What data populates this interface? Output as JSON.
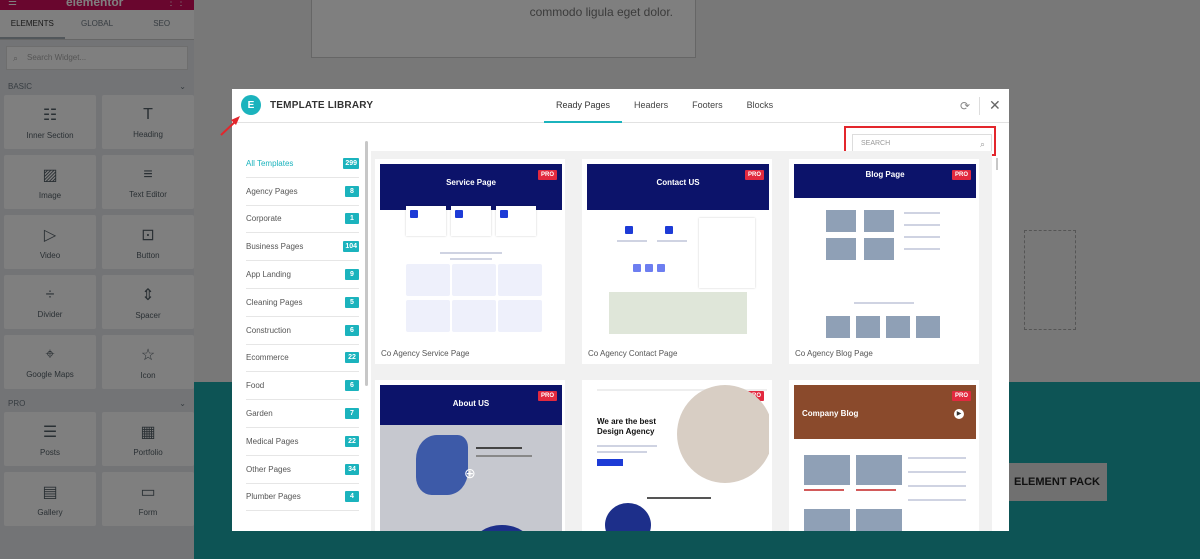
{
  "editor": {
    "logo": "elementor",
    "tabs": [
      "ELEMENTS",
      "GLOBAL",
      "SEO"
    ],
    "search_placeholder": "Search Widget...",
    "basic_title": "BASIC",
    "pro_title": "PRO",
    "basic_widgets": [
      "Inner Section",
      "Heading",
      "Image",
      "Text Editor",
      "Video",
      "Button",
      "Divider",
      "Spacer",
      "Google Maps",
      "Icon"
    ],
    "pro_widgets": [
      "Posts",
      "Portfolio",
      "Gallery",
      "Form"
    ]
  },
  "canvas": {
    "box_text": "commodo ligula eget dolor.",
    "button_text": "ELEMENT PACK"
  },
  "modal": {
    "title": "TEMPLATE LIBRARY",
    "logo_letter": "E",
    "tabs": [
      "Ready Pages",
      "Headers",
      "Footers",
      "Blocks"
    ],
    "active_tab": "Ready Pages",
    "search_placeholder": "SEARCH",
    "categories": [
      {
        "label": "All Templates",
        "count": "299"
      },
      {
        "label": "Agency Pages",
        "count": "8"
      },
      {
        "label": "Corporate",
        "count": "1"
      },
      {
        "label": "Business Pages",
        "count": "104"
      },
      {
        "label": "App Landing",
        "count": "9"
      },
      {
        "label": "Cleaning Pages",
        "count": "5"
      },
      {
        "label": "Construction",
        "count": "6"
      },
      {
        "label": "Ecommerce",
        "count": "22"
      },
      {
        "label": "Food",
        "count": "6"
      },
      {
        "label": "Garden",
        "count": "7"
      },
      {
        "label": "Medical Pages",
        "count": "22"
      },
      {
        "label": "Other Pages",
        "count": "34"
      },
      {
        "label": "Plumber Pages",
        "count": "4"
      }
    ],
    "templates": [
      {
        "caption": "Co Agency Service Page",
        "heading": "Service Page",
        "badge": "PRO"
      },
      {
        "caption": "Co Agency Contact Page",
        "heading": "Contact US",
        "badge": "PRO"
      },
      {
        "caption": "Co Agency Blog Page",
        "heading": "Blog Page",
        "badge": "PRO"
      },
      {
        "caption": "",
        "heading": "About US",
        "badge": "PRO"
      },
      {
        "caption": "",
        "heading": "We are the best Design Agency",
        "badge": "PRO"
      },
      {
        "caption": "",
        "heading": "Company Blog",
        "badge": "PRO"
      }
    ]
  },
  "colors": {
    "accent": "#1bb3bd",
    "pro_badge": "#e2293f",
    "highlight": "#e3262c",
    "navy": "#0c136a"
  }
}
